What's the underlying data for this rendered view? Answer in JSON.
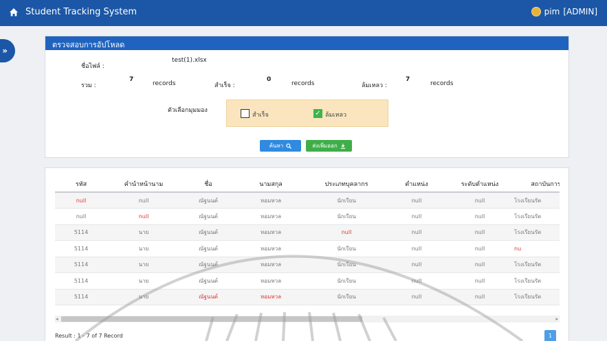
{
  "navbar": {
    "title": "Student Tracking System",
    "user": "pim",
    "role": "[ADMIN]"
  },
  "sidebar_toggle": "»",
  "upload": {
    "heading": "ตรวจสอบการอัปโหลด",
    "filename_label": "ชื่อไฟล์ :",
    "filename": "test(1).xlsx",
    "total_label": "รวม :",
    "total": "7",
    "success_label": "สำเร็จ :",
    "success": "0",
    "failed_label": "ล้มเหลว :",
    "failed": "7",
    "records_unit": "records",
    "view_options_label": "ตัวเลือกมุมมอง",
    "option_success": "สำเร็จ",
    "option_failed": "ล้มเหลว",
    "search_button": "ค้นหา",
    "export_button": "ส่งเพิ่มออก"
  },
  "table": {
    "columns": [
      "รหัส",
      "คำนำหน้านาม",
      "ชื่อ",
      "นามสกุล",
      "ประเภทบุคลากร",
      "ตำแหน่ง",
      "ระดับตำแหน่ง",
      "สถาบันการ"
    ],
    "rows": [
      [
        "null",
        "null",
        "ณัฐนนต์",
        "หอมหวล",
        "นักเรียน",
        "null",
        "null",
        "โรงเรียนรัต"
      ],
      [
        "null",
        "null",
        "ณัฐนนต์",
        "หอมหวล",
        "นักเรียน",
        "null",
        "null",
        "โรงเรียนรัต"
      ],
      [
        "5114",
        "นาย",
        "ณัฐนนต์",
        "หอมหวล",
        "null",
        "null",
        "null",
        "โรงเรียนรัต"
      ],
      [
        "5114",
        "นาย",
        "ณัฐนนต์",
        "หอมหวล",
        "นักเรียน",
        "null",
        "null",
        "nu"
      ],
      [
        "5114",
        "นาย",
        "ณัฐนนต์",
        "หอมหวล",
        "นักเรียน",
        "null",
        "null",
        "โรงเรียนรัต"
      ],
      [
        "5114",
        "นาย",
        "ณัฐนนต์",
        "หอมหวล",
        "นักเรียน",
        "null",
        "null",
        "โรงเรียนรัต"
      ],
      [
        "5114",
        "นาย",
        "ณัฐนนต์",
        "หอมหวล",
        "นักเรียน",
        "null",
        "null",
        "โรงเรียนรัต"
      ]
    ],
    "error_cells": [
      [
        0,
        0
      ],
      [
        1,
        1
      ],
      [
        2,
        4
      ],
      [
        3,
        7
      ],
      [
        6,
        2
      ],
      [
        6,
        3
      ]
    ]
  },
  "result_text": "Result : 1 - 7 of 7 Record",
  "pagination": {
    "current_page": "1"
  },
  "colors": {
    "navbar": "#1b57a6",
    "panel_head": "#1f63bf",
    "error": "#e03535",
    "search_btn": "#2f8ae0",
    "export_btn": "#3fae49",
    "option_bg": "#fae5bf"
  }
}
